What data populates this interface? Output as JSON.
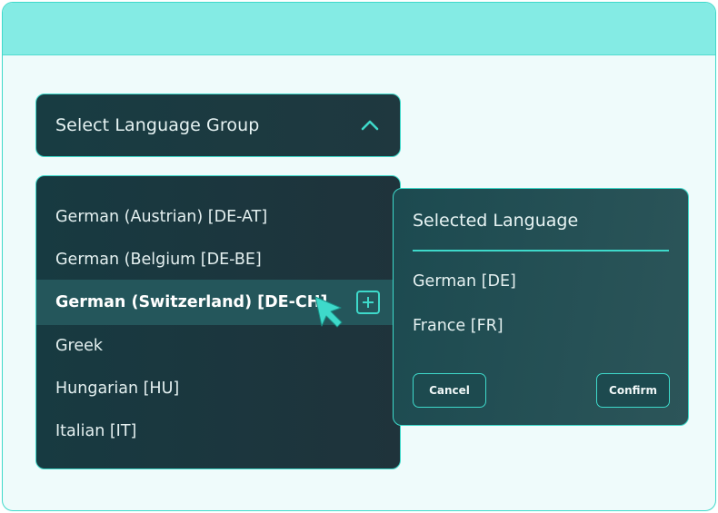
{
  "select": {
    "label": "Select Language Group",
    "chevron_icon": "chevron-up-icon"
  },
  "dropdown": {
    "options": [
      {
        "label": "German (Austrian) [DE-AT]",
        "highlighted": false
      },
      {
        "label": "German (Belgium [DE-BE]",
        "highlighted": false
      },
      {
        "label": "German (Switzerland) [DE-CH]",
        "highlighted": true
      },
      {
        "label": "Greek",
        "highlighted": false
      },
      {
        "label": "Hungarian [HU]",
        "highlighted": false
      },
      {
        "label": "Italian [IT]",
        "highlighted": false
      }
    ],
    "add_icon": "plus-square-icon"
  },
  "selected_panel": {
    "title": "Selected Language",
    "items": [
      "German [DE]",
      "France [FR]"
    ],
    "cancel_label": "Cancel",
    "confirm_label": "Confirm"
  },
  "colors": {
    "accent": "#3ed9ca",
    "titlebar": "#84ebe4",
    "background": "#effbfb",
    "panel_dark": "#1c3a40",
    "highlight_row": "#24565b"
  }
}
